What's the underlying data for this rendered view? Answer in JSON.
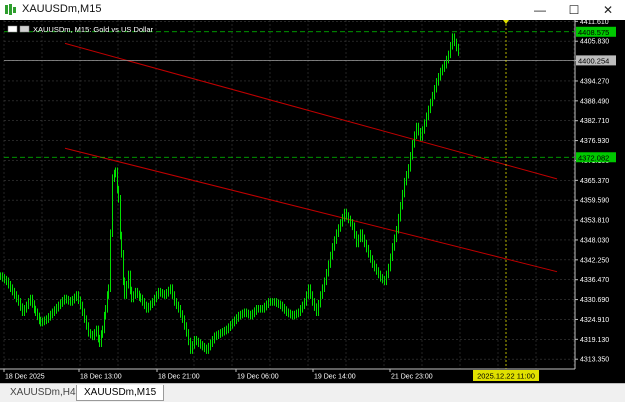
{
  "window": {
    "title": "XAUUSDm,M15"
  },
  "window_controls": {
    "minimize": "—",
    "maximize": "☐",
    "close": "✕"
  },
  "chart_header": {
    "text": "XAUUSDm, M15:  Gold vs US Dollar"
  },
  "price_labels": [
    {
      "value": "4411.610"
    },
    {
      "value": "4405.830"
    },
    {
      "value": "4400.250"
    },
    {
      "value": "4394.270"
    },
    {
      "value": "4388.490"
    },
    {
      "value": "4382.710"
    },
    {
      "value": "4376.930"
    },
    {
      "value": "4371.150"
    },
    {
      "value": "4365.370"
    },
    {
      "value": "4359.590"
    },
    {
      "value": "4353.810"
    },
    {
      "value": "4348.030"
    },
    {
      "value": "4342.250"
    },
    {
      "value": "4336.470"
    },
    {
      "value": "4330.690"
    },
    {
      "value": "4324.910"
    },
    {
      "value": "4319.130"
    },
    {
      "value": "4313.350"
    }
  ],
  "highlight_labels": {
    "top_level": "4408.575",
    "current_price": "4400.254",
    "mid_level": "4372.082"
  },
  "time_labels": [
    "18 Dec 2025",
    "18 Dec 13:00",
    "18 Dec 21:00",
    "19 Dec 06:00",
    "19 Dec 14:00",
    "21 Dec 23:00"
  ],
  "crosshair_time": "2025.12.22 11:00",
  "tabs": [
    {
      "label": "XAUUSDm,H4",
      "active": false
    },
    {
      "label": "XAUUSDm,M15",
      "active": true
    }
  ],
  "colors": {
    "background": "#000000",
    "grid": "#3c3c3c",
    "candles": "#00e000",
    "trendline": "#c00000",
    "level_line": "#00c800",
    "current_price_line": "#9e9e9e",
    "crosshair": "#e0e000",
    "axis_text": "#ffffff"
  },
  "chart_data": {
    "type": "candlestick",
    "symbol": "XAUUSDm",
    "timeframe": "M15",
    "ylim": [
      4310.5,
      4412
    ],
    "price_path": [
      [
        0,
        4337.5
      ],
      [
        6,
        4336
      ],
      [
        12,
        4333
      ],
      [
        18,
        4330
      ],
      [
        22,
        4327
      ],
      [
        26,
        4329
      ],
      [
        30,
        4331
      ],
      [
        35,
        4327
      ],
      [
        40,
        4324
      ],
      [
        46,
        4325
      ],
      [
        52,
        4327
      ],
      [
        58,
        4329
      ],
      [
        64,
        4331
      ],
      [
        70,
        4330
      ],
      [
        76,
        4332
      ],
      [
        80,
        4329
      ],
      [
        84,
        4325
      ],
      [
        88,
        4321
      ],
      [
        92,
        4320
      ],
      [
        96,
        4322
      ],
      [
        99,
        4318
      ],
      [
        102,
        4322
      ],
      [
        105,
        4328
      ],
      [
        108,
        4334
      ],
      [
        110,
        4350
      ],
      [
        112,
        4366
      ],
      [
        115,
        4368
      ],
      [
        118,
        4360
      ],
      [
        121,
        4344
      ],
      [
        124,
        4332
      ],
      [
        128,
        4338
      ],
      [
        131,
        4331
      ],
      [
        135,
        4333
      ],
      [
        140,
        4331
      ],
      [
        146,
        4328
      ],
      [
        152,
        4330
      ],
      [
        158,
        4333
      ],
      [
        164,
        4332
      ],
      [
        170,
        4334
      ],
      [
        174,
        4330
      ],
      [
        178,
        4328
      ],
      [
        182,
        4325
      ],
      [
        186,
        4321
      ],
      [
        190,
        4316
      ],
      [
        194,
        4319
      ],
      [
        198,
        4318
      ],
      [
        202,
        4317
      ],
      [
        206,
        4316
      ],
      [
        210,
        4318
      ],
      [
        214,
        4320
      ],
      [
        220,
        4321
      ],
      [
        226,
        4322
      ],
      [
        232,
        4324
      ],
      [
        238,
        4326
      ],
      [
        244,
        4327
      ],
      [
        250,
        4326
      ],
      [
        256,
        4328
      ],
      [
        262,
        4328
      ],
      [
        268,
        4330
      ],
      [
        274,
        4330
      ],
      [
        280,
        4329
      ],
      [
        286,
        4327
      ],
      [
        292,
        4326
      ],
      [
        298,
        4327
      ],
      [
        304,
        4330
      ],
      [
        308,
        4334
      ],
      [
        312,
        4330
      ],
      [
        316,
        4327
      ],
      [
        320,
        4332
      ],
      [
        324,
        4336
      ],
      [
        328,
        4341
      ],
      [
        332,
        4346
      ],
      [
        336,
        4350
      ],
      [
        340,
        4353
      ],
      [
        344,
        4356
      ],
      [
        348,
        4354
      ],
      [
        352,
        4352
      ],
      [
        356,
        4347
      ],
      [
        360,
        4350
      ],
      [
        364,
        4347
      ],
      [
        368,
        4344
      ],
      [
        372,
        4341
      ],
      [
        376,
        4339
      ],
      [
        380,
        4337
      ],
      [
        384,
        4336
      ],
      [
        388,
        4340
      ],
      [
        392,
        4346
      ],
      [
        396,
        4351
      ],
      [
        400,
        4358
      ],
      [
        404,
        4365
      ],
      [
        408,
        4369
      ],
      [
        412,
        4376
      ],
      [
        416,
        4381
      ],
      [
        420,
        4378
      ],
      [
        424,
        4382
      ],
      [
        428,
        4386
      ],
      [
        432,
        4390
      ],
      [
        436,
        4394
      ],
      [
        440,
        4397
      ],
      [
        444,
        4399
      ],
      [
        448,
        4402
      ],
      [
        452,
        4407
      ],
      [
        456,
        4404
      ],
      [
        459,
        4402
      ]
    ],
    "trendlines": [
      {
        "from": [
          65,
          4405.2
        ],
        "to": [
          557,
          4365.8
        ]
      },
      {
        "from": [
          65,
          4374.7
        ],
        "to": [
          557,
          4338.8
        ]
      }
    ],
    "horizontal_levels": [
      4408.575,
      4400.254,
      4372.082
    ],
    "vertical_marker_x": 506,
    "x_tick_positions": [
      4,
      79,
      157,
      236,
      313,
      390
    ]
  }
}
